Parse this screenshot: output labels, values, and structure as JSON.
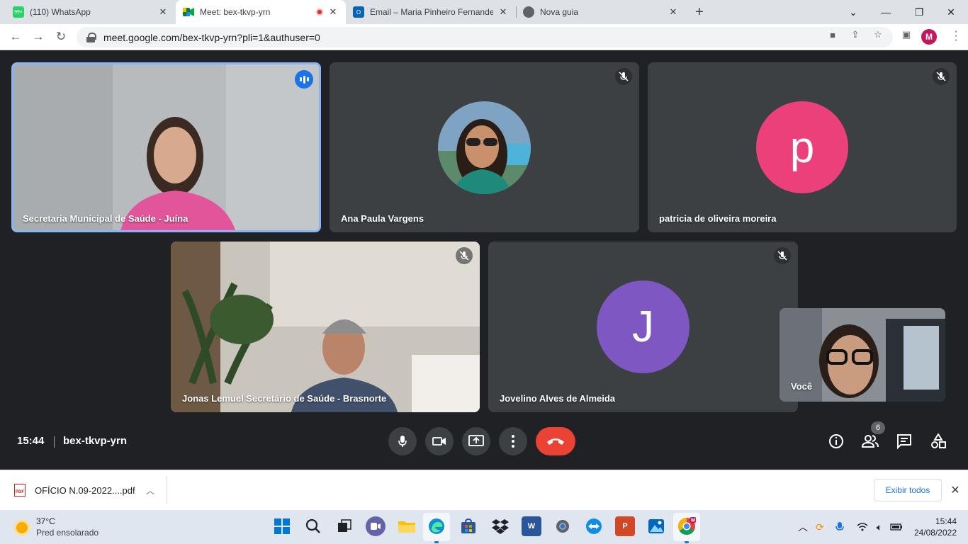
{
  "browser": {
    "tabs": [
      {
        "title": "(110) WhatsApp",
        "badge": "99+",
        "icon": "whatsapp-icon",
        "color": "#25d366"
      },
      {
        "title": "Meet: bex-tkvp-yrn",
        "icon": "meet-icon",
        "active": true,
        "recording": true
      },
      {
        "title": "Email – Maria Pinheiro Fernandes",
        "icon": "outlook-icon",
        "color": "#0364b8"
      },
      {
        "title": "Nova guia",
        "icon": "chrome-icon",
        "color": "#5f6368"
      }
    ],
    "url": "meet.google.com/bex-tkvp-yrn?pli=1&authuser=0",
    "profile_initial": "M"
  },
  "meet": {
    "participants": [
      {
        "name": "Secretaria Municipal de Saúde - Juína",
        "type": "video",
        "speaking": true
      },
      {
        "name": "Ana Paula Vargens",
        "type": "photo",
        "muted": true
      },
      {
        "name": "patricia de oliveira moreira",
        "type": "initial",
        "initial": "p",
        "color": "#ec407a",
        "muted": true
      },
      {
        "name": "Jonas Lemuel Secretário de Saúde - Brasnorte",
        "type": "video",
        "muted": true
      },
      {
        "name": "Jovelino Alves de Almeida",
        "type": "initial",
        "initial": "J",
        "color": "#7e57c2",
        "muted": true
      }
    ],
    "self_label": "Você",
    "time": "15:44",
    "meeting_code": "bex-tkvp-yrn",
    "participant_count": "6",
    "hangup_color": "#ea4335"
  },
  "downloads": {
    "file_name": "OFÍCIO N.09-2022....pdf",
    "file_icon_label": "PDF",
    "show_all": "Exibir todos"
  },
  "taskbar": {
    "weather_temp": "37°C",
    "weather_desc": "Pred ensolarado",
    "time": "15:44",
    "date": "24/08/2022",
    "chrome_profile": "M",
    "word_label": "W",
    "ppt_label": "P"
  }
}
